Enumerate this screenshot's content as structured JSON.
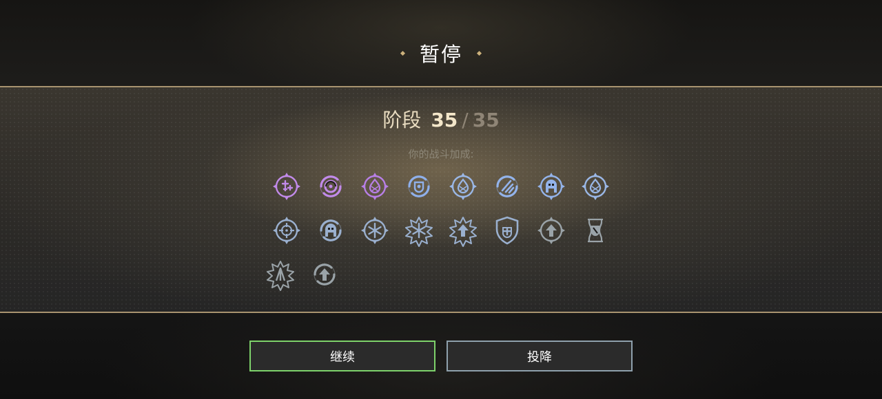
{
  "title": "暂停",
  "stage": {
    "label": "阶段",
    "current": "35",
    "separator": "/",
    "total": "35"
  },
  "bonus_label": "你的战斗加成:",
  "buffs": {
    "row1": [
      {
        "icon": "crosshair-plus-icon",
        "color": "#c18ae9"
      },
      {
        "icon": "swirl-eye-icon",
        "color": "#c18ae9"
      },
      {
        "icon": "flame-crest-icon",
        "color": "#b77fe6"
      },
      {
        "icon": "shield-vortex-icon",
        "color": "#8fb0ea"
      },
      {
        "icon": "flame-crest-icon",
        "color": "#9ab7e6"
      },
      {
        "icon": "slash-vortex-icon",
        "color": "#93b3ea"
      },
      {
        "icon": "golem-head-icon",
        "color": "#93b3ea"
      },
      {
        "icon": "flame-crest-icon",
        "color": "#9ab7e6"
      }
    ],
    "row2": [
      {
        "icon": "crosshair-icon",
        "color": "#9ab0cf"
      },
      {
        "icon": "golem-vortex-icon",
        "color": "#9ab0cf"
      },
      {
        "icon": "snowflake-icon",
        "color": "#9ab0cf"
      },
      {
        "icon": "snowflake-shield-icon",
        "color": "#9ab0cf"
      },
      {
        "icon": "arrow-up-gear-icon",
        "color": "#9ab0cf"
      },
      {
        "icon": "shield-plus-icon",
        "color": "#9ab0cf"
      },
      {
        "icon": "arrow-up-crest-icon",
        "color": "#9aa3a8"
      },
      {
        "icon": "shield-hourglass-icon",
        "color": "#9aa3a8"
      }
    ],
    "row3": [
      {
        "icon": "arrow-spikes-icon",
        "color": "#9aa3a8"
      },
      {
        "icon": "arrow-up-vortex-icon",
        "color": "#9aa3a8"
      }
    ]
  },
  "buttons": {
    "continue": "继续",
    "surrender": "投降"
  },
  "colors": {
    "continue_border": "#7ed36b",
    "surrender_border": "#8fa1ad",
    "panel_border": "#a99470"
  }
}
